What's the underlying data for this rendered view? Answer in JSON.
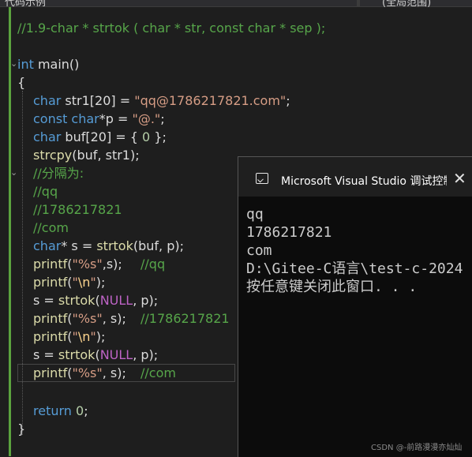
{
  "tabs": {
    "left": "代码示例",
    "right": "(全局范围)"
  },
  "code_lines": {
    "l1": "//1.9-char * strtok ( char * str, const char * sep );",
    "l3_kw": "int",
    "l3_rest": " main()",
    "l4": "{",
    "l5_kw": "char",
    "l5_a": " str1[20] = ",
    "l5_str": "\"qq@1786217821.com\"",
    "l5_b": ";",
    "l6_kw1": "const",
    "l6_kw2": " char",
    "l6_a": "*p = ",
    "l6_str": "\"@.\"",
    "l6_b": ";",
    "l7_kw": "char",
    "l7_a": " buf[20] = { ",
    "l7_num": "0",
    "l7_b": " };",
    "l8_fn": "strcpy",
    "l8_a": "(buf, str1);",
    "l9": "//分隔为:",
    "l10": "//qq",
    "l11": "//1786217821",
    "l12": "//com",
    "l13_kw": "char",
    "l13_a": "* s = ",
    "l13_fn": "strtok",
    "l13_b": "(buf, p);",
    "l14_fn": "printf",
    "l14_a": "(",
    "l14_str": "\"%s\"",
    "l14_b": ",s);",
    "l14_cm": "//qq",
    "l15_fn": "printf",
    "l15_a": "(",
    "l15_q1": "\"",
    "l15_esc": "\\n",
    "l15_q2": "\"",
    "l15_b": ");",
    "l16_a": "s = ",
    "l16_fn": "strtok",
    "l16_b": "(",
    "l16_mac": "NULL",
    "l16_c": ", p);",
    "l17_fn": "printf",
    "l17_a": "(",
    "l17_str": "\"%s\"",
    "l17_b": ", s);",
    "l17_cm": "//1786217821",
    "l18_fn": "printf",
    "l18_a": "(",
    "l18_q1": "\"",
    "l18_esc": "\\n",
    "l18_q2": "\"",
    "l18_b": ");",
    "l19_a": "s = ",
    "l19_fn": "strtok",
    "l19_b": "(",
    "l19_mac": "NULL",
    "l19_c": ", p);",
    "l20_fn": "printf",
    "l20_a": "(",
    "l20_str": "\"%s\"",
    "l20_b": ", s);",
    "l20_cm": "//com",
    "l22_kw": "return",
    "l22_num": " 0",
    "l22_a": ";",
    "l23": "}"
  },
  "fold_markers": {
    "main": "⌄",
    "comment": "⌄"
  },
  "console": {
    "title": "Microsoft Visual Studio 调试控制台",
    "close_glyph": "✕",
    "lines": [
      "qq",
      "1786217821",
      "com",
      "D:\\Gitee-C语言\\test-c-2024",
      "按任意键关闭此窗口. . ."
    ]
  },
  "watermark": "CSDN @-前路漫漫亦灿灿"
}
